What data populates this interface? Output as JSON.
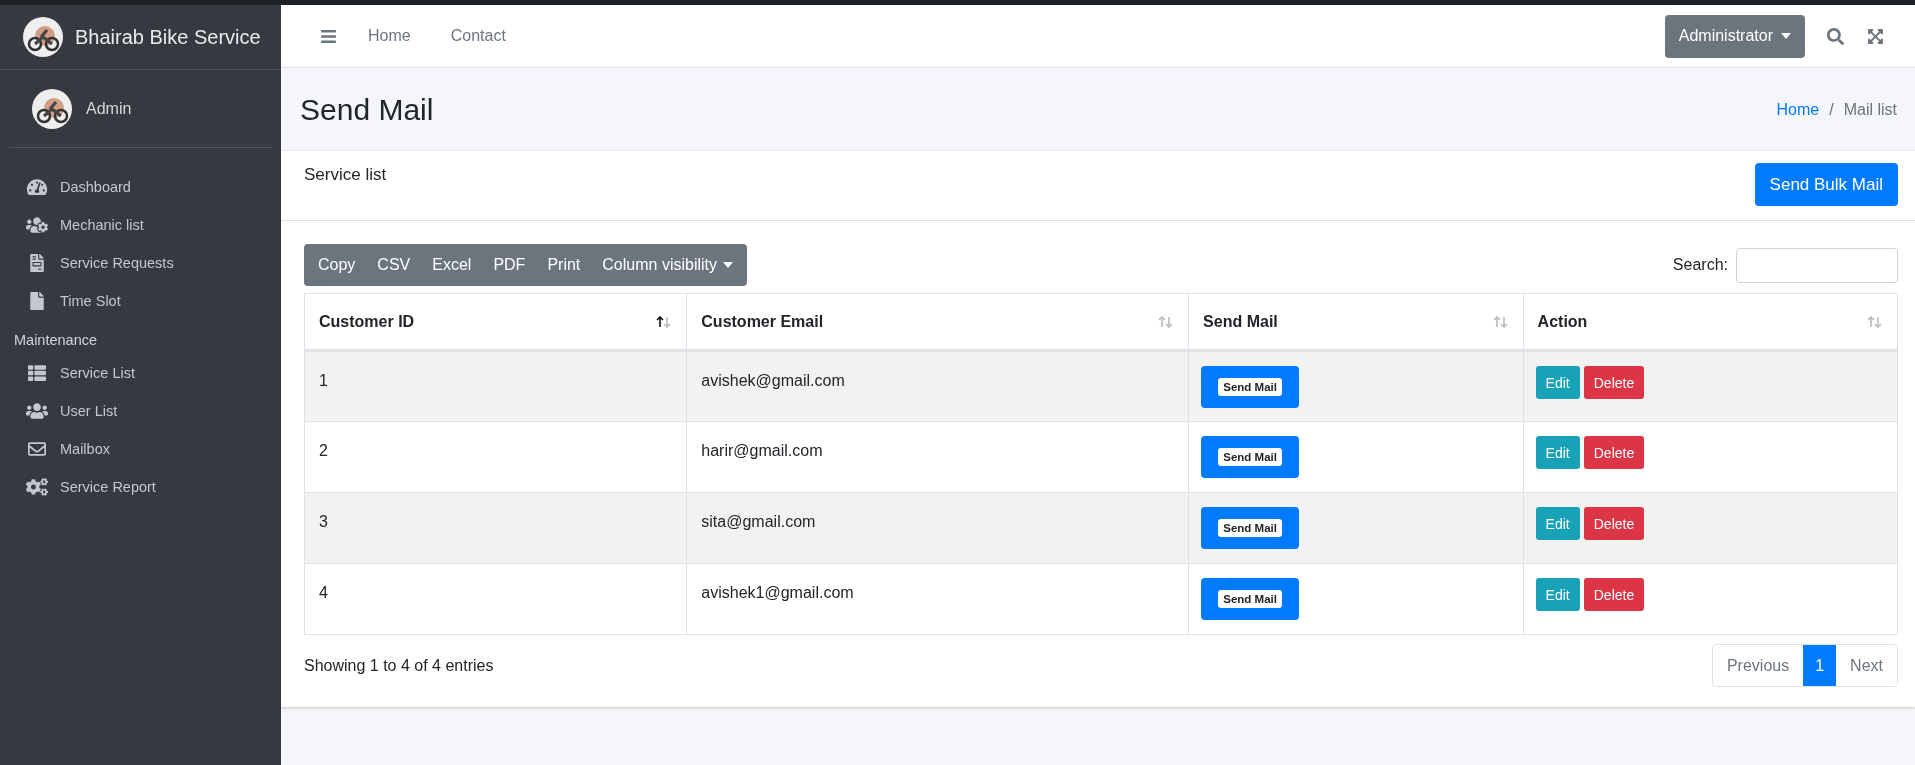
{
  "sidebar": {
    "brand": "Bhairab Bike Service",
    "user": "Admin",
    "sections": [
      {
        "items": [
          "Dashboard",
          "Mechanic list",
          "Service Requests",
          "Time Slot"
        ]
      },
      {
        "header": "Maintenance",
        "items": [
          "Service List",
          "User List",
          "Mailbox",
          "Service Report"
        ]
      }
    ]
  },
  "navbar": {
    "links": [
      "Home",
      "Contact"
    ],
    "user_menu": "Administrator"
  },
  "page": {
    "title": "Send Mail",
    "breadcrumb_separator": "/",
    "breadcrumb": [
      {
        "label": "Home",
        "kind": "link"
      },
      {
        "label": "Mail list",
        "kind": "current"
      }
    ]
  },
  "card": {
    "title": "Service list",
    "bulk_button": "Send Bulk Mail",
    "export_buttons": [
      "Copy",
      "CSV",
      "Excel",
      "PDF",
      "Print"
    ],
    "column_visibility": "Column visibility",
    "search_label": "Search:",
    "columns": [
      {
        "label": "Customer ID",
        "sorted": true
      },
      {
        "label": "Customer Email",
        "sorted": false
      },
      {
        "label": "Send Mail",
        "sorted": false
      },
      {
        "label": "Action",
        "sorted": false
      }
    ],
    "rows": [
      {
        "id": "1",
        "email": "avishek@gmail.com",
        "send": "Send Mail",
        "edit": "Edit",
        "delete": "Delete"
      },
      {
        "id": "2",
        "email": "harir@gmail.com",
        "send": "Send Mail",
        "edit": "Edit",
        "delete": "Delete"
      },
      {
        "id": "3",
        "email": "sita@gmail.com",
        "send": "Send Mail",
        "edit": "Edit",
        "delete": "Delete"
      },
      {
        "id": "4",
        "email": "avishek1@gmail.com",
        "send": "Send Mail",
        "edit": "Edit",
        "delete": "Delete"
      }
    ],
    "info": "Showing 1 to 4 of 4 entries",
    "pagination": {
      "previous": {
        "label": "Previous",
        "disabled": true
      },
      "pages": [
        {
          "label": "1",
          "selected": true
        }
      ],
      "next": {
        "label": "Next",
        "disabled": true
      }
    }
  }
}
